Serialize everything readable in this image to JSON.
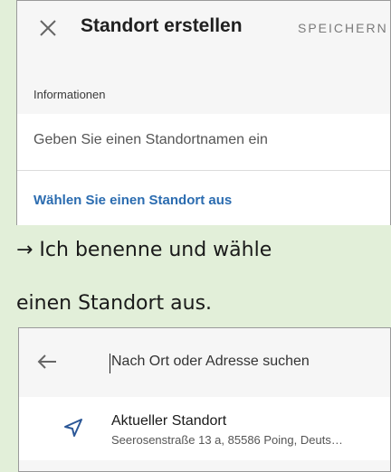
{
  "top_screen": {
    "title": "Standort erstellen",
    "save_label": "SPEICHERN",
    "section_label": "Informationen",
    "name_placeholder": "Geben Sie einen Standortnamen ein",
    "select_location_label": "Wählen Sie einen Standort aus"
  },
  "caption": {
    "line1": "→ Ich benenne und wähle",
    "line2": "einen Standort aus."
  },
  "bottom_screen": {
    "search_placeholder": "Nach Ort oder Adresse suchen",
    "current_location": {
      "title": "Aktueller Standort",
      "address": "Seerosenstraße 13 a, 85586 Poing, Deuts…"
    }
  },
  "colors": {
    "background": "#e2efd9",
    "link_blue": "#2b6cb0",
    "icon_blue": "#2b5797"
  },
  "icons": [
    "close-icon",
    "back-arrow-icon",
    "location-arrow-icon"
  ]
}
